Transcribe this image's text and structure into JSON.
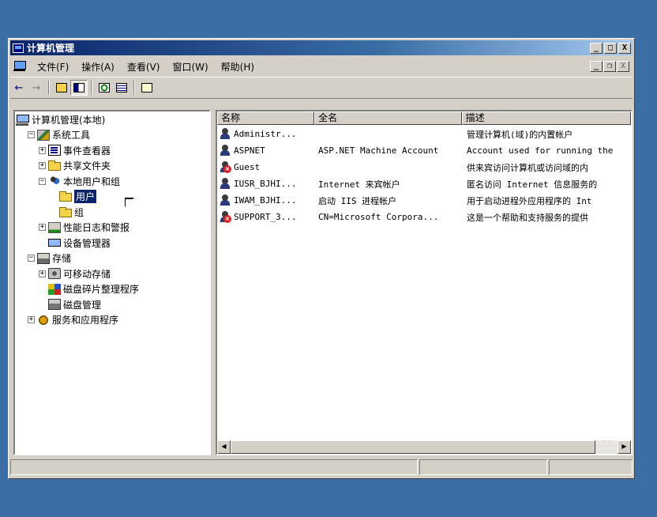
{
  "window": {
    "title": "计算机管理"
  },
  "caption_buttons": {
    "minimize": "_",
    "maximize": "□",
    "close": "X"
  },
  "mdi_buttons": {
    "minimize": "_",
    "restore": "❐",
    "close": "X"
  },
  "menu": [
    {
      "label": "文件(F)"
    },
    {
      "label": "操作(A)"
    },
    {
      "label": "查看(V)"
    },
    {
      "label": "窗口(W)"
    },
    {
      "label": "帮助(H)"
    }
  ],
  "toolbar": {
    "back_icon": "←",
    "forward_icon": "→"
  },
  "tree": [
    {
      "label": "计算机管理(本地)",
      "icon": "computer",
      "level": 0,
      "expander": ""
    },
    {
      "label": "系统工具",
      "icon": "tools",
      "level": 1,
      "expander": "−"
    },
    {
      "label": "事件查看器",
      "icon": "log",
      "level": 2,
      "expander": "+"
    },
    {
      "label": "共享文件夹",
      "icon": "folder",
      "level": 2,
      "expander": "+"
    },
    {
      "label": "本地用户和组",
      "icon": "users",
      "level": 2,
      "expander": "−"
    },
    {
      "label": "用户",
      "icon": "folder",
      "level": 3,
      "expander": "",
      "selected": true
    },
    {
      "label": "组",
      "icon": "folder",
      "level": 3,
      "expander": ""
    },
    {
      "label": "性能日志和警报",
      "icon": "perf",
      "level": 2,
      "expander": "+"
    },
    {
      "label": "设备管理器",
      "icon": "device",
      "level": 2,
      "expander": ""
    },
    {
      "label": "存储",
      "icon": "storage",
      "level": 1,
      "expander": "−"
    },
    {
      "label": "可移动存储",
      "icon": "removable",
      "level": 2,
      "expander": "+"
    },
    {
      "label": "磁盘碎片整理程序",
      "icon": "defrag",
      "level": 2,
      "expander": ""
    },
    {
      "label": "磁盘管理",
      "icon": "disk",
      "level": 2,
      "expander": ""
    },
    {
      "label": "服务和应用程序",
      "icon": "services",
      "level": 1,
      "expander": "+"
    }
  ],
  "list": {
    "columns": [
      "名称",
      "全名",
      "描述"
    ],
    "rows": [
      {
        "name": "Administr...",
        "fullname": "",
        "description": "管理计算机(域)的内置帐户",
        "disabled": false
      },
      {
        "name": "ASPNET",
        "fullname": "ASP.NET Machine Account",
        "description": "Account used for running the",
        "disabled": false
      },
      {
        "name": "Guest",
        "fullname": "",
        "description": "供来宾访问计算机或访问域的内",
        "disabled": true
      },
      {
        "name": "IUSR_BJHI...",
        "fullname": "Internet 来宾帐户",
        "description": "匿名访问 Internet 信息服务的",
        "disabled": false
      },
      {
        "name": "IWAM_BJHI...",
        "fullname": "启动 IIS 进程帐户",
        "description": "用于启动进程外应用程序的 Int",
        "disabled": false
      },
      {
        "name": "SUPPORT_3...",
        "fullname": "CN=Microsoft Corpora...",
        "description": "这是一个帮助和支持服务的提供",
        "disabled": true
      }
    ]
  },
  "scrollbar": {
    "left_arrow": "◀",
    "right_arrow": "▶"
  }
}
